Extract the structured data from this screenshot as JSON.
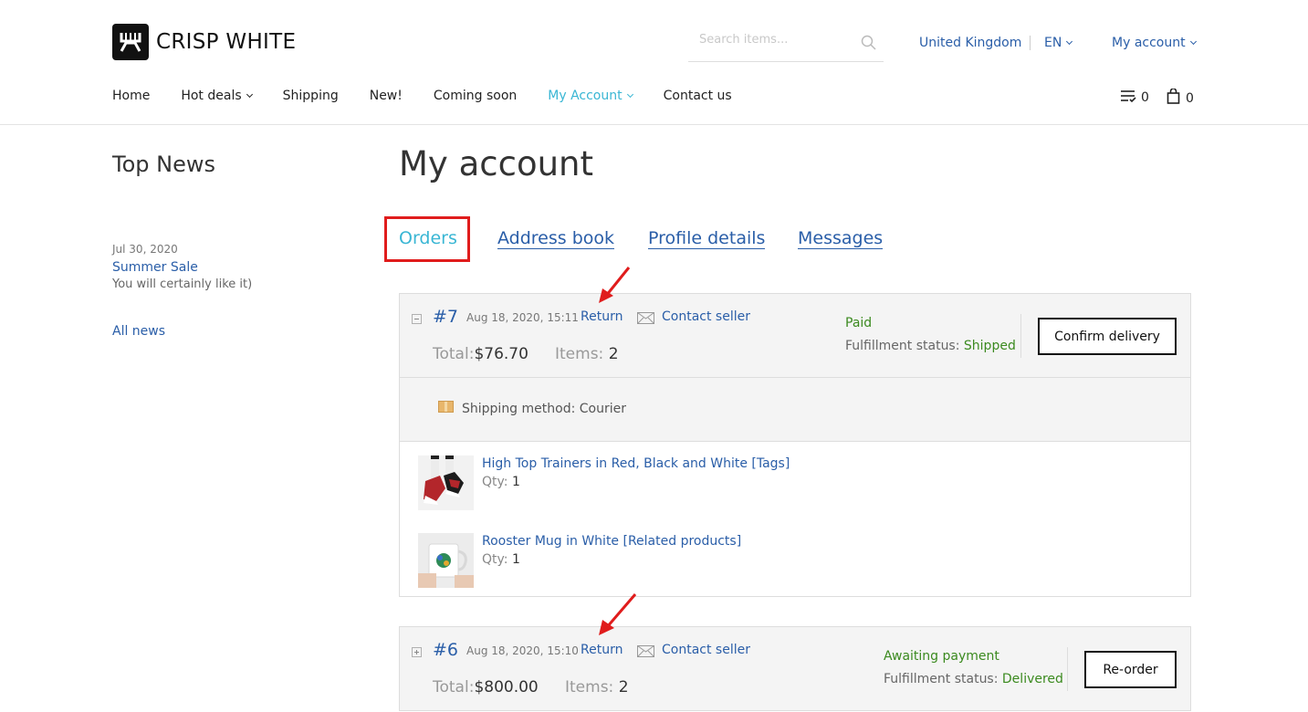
{
  "brand": {
    "name": "CRISP WHITE"
  },
  "search": {
    "placeholder": "Search items..."
  },
  "header": {
    "country": "United Kingdom",
    "language": "EN",
    "account": "My account"
  },
  "nav": {
    "items": [
      {
        "label": "Home"
      },
      {
        "label": "Hot deals"
      },
      {
        "label": "Shipping"
      },
      {
        "label": "New!"
      },
      {
        "label": "Coming soon"
      },
      {
        "label": "My Account"
      },
      {
        "label": "Contact us"
      }
    ],
    "wishlist_count": "0",
    "cart_count": "0"
  },
  "sidebar": {
    "title": "Top News",
    "news": [
      {
        "date": "Jul 30, 2020",
        "title": "Summer Sale",
        "desc": "You will certainly like it)"
      }
    ],
    "all_news": "All news"
  },
  "main": {
    "title": "My account",
    "tabs": [
      {
        "label": "Orders"
      },
      {
        "label": "Address book"
      },
      {
        "label": "Profile details"
      },
      {
        "label": "Messages"
      }
    ]
  },
  "orders": [
    {
      "number": "#7",
      "date": "Aug 18, 2020, 15:11",
      "return_label": "Return",
      "contact_label": "Contact seller",
      "total_label": "Total:",
      "total": "$76.70",
      "items_label": "Items:",
      "items": "2",
      "status": "Paid",
      "fulfillment_label": "Fulfillment status:",
      "fulfillment": "Shipped",
      "action": "Confirm delivery",
      "shipping_label": "Shipping method:",
      "shipping_method": "Courier",
      "products": [
        {
          "name": "High Top Trainers in Red, Black and White [Tags]",
          "qty_label": "Qty:",
          "qty": "1"
        },
        {
          "name": "Rooster Mug in White [Related products]",
          "qty_label": "Qty:",
          "qty": "1"
        }
      ]
    },
    {
      "number": "#6",
      "date": "Aug 18, 2020, 15:10",
      "return_label": "Return",
      "contact_label": "Contact seller",
      "total_label": "Total:",
      "total": "$800.00",
      "items_label": "Items:",
      "items": "2",
      "status": "Awaiting payment",
      "fulfillment_label": "Fulfillment status:",
      "fulfillment": "Delivered",
      "action": "Re-order"
    }
  ],
  "colors": {
    "link": "#2a5ea8",
    "active": "#39b6d4",
    "status_green": "#3b8a1f",
    "annotation_red": "#e01c1c"
  }
}
